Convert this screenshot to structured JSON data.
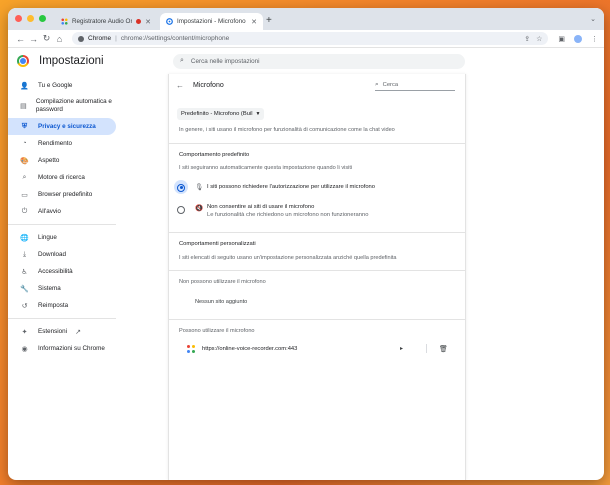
{
  "window": {
    "traffic_colors": [
      "#ff5f57",
      "#febc2e",
      "#28c840"
    ]
  },
  "tabs": [
    {
      "title": "Registratore Audio Online",
      "active": false,
      "recording": true
    },
    {
      "title": "Impostazioni - Microfono",
      "active": true,
      "recording": false
    }
  ],
  "toolbar": {
    "chip": "Chrome",
    "separator": "|",
    "url": "chrome://settings/content/microphone"
  },
  "header": {
    "title": "Impostazioni",
    "search_placeholder": "Cerca nelle impostazioni"
  },
  "sidebar": {
    "items": [
      {
        "label": "Tu e Google",
        "icon": "person-icon"
      },
      {
        "label": "Compilazione automatica e password",
        "icon": "clipboard-icon"
      },
      {
        "label": "Privacy e sicurezza",
        "icon": "shield-icon",
        "selected": true
      },
      {
        "label": "Rendimento",
        "icon": "speed-icon"
      },
      {
        "label": "Aspetto",
        "icon": "palette-icon"
      },
      {
        "label": "Motore di ricerca",
        "icon": "search-icon"
      },
      {
        "label": "Browser predefinito",
        "icon": "browser-icon"
      },
      {
        "label": "All'avvio",
        "icon": "power-icon"
      },
      {
        "label": "Lingue",
        "icon": "globe-icon"
      },
      {
        "label": "Download",
        "icon": "download-icon"
      },
      {
        "label": "Accessibilità",
        "icon": "accessibility-icon"
      },
      {
        "label": "Sistema",
        "icon": "wrench-icon"
      },
      {
        "label": "Reimposta",
        "icon": "reset-icon"
      },
      {
        "label": "Estensioni",
        "icon": "puzzle-icon"
      },
      {
        "label": "Informazioni su Chrome",
        "icon": "chrome-icon"
      }
    ]
  },
  "main": {
    "title": "Microfono",
    "search_placeholder": "Cerca",
    "device_select": "Predefinito - Microfono (Buil",
    "intro": "In genere, i siti usano il microfono per funzionalità di comunicazione come la chat video",
    "default_behavior": {
      "heading": "Comportamento predefinito",
      "description": "I siti seguiranno automaticamente questa impostazione quando li visiti",
      "option_allow": "I siti possono richiedere l'autorizzazione per utilizzare il microfono",
      "option_block_title": "Non consentire ai siti di usare il microfono",
      "option_block_sub": "Le funzionalità che richiedono un microfono non funzioneranno"
    },
    "custom_behavior": {
      "heading": "Comportamenti personalizzati",
      "description": "I siti elencati di seguito usano un'impostazione personalizzata anziché quella predefinita",
      "blocked_heading": "Non possono utilizzare il microfono",
      "blocked_empty": "Nessun sito aggiunto",
      "allowed_heading": "Possono utilizzare il microfono",
      "allowed_sites": [
        {
          "url": "https://online-voice-recorder.com:443"
        }
      ]
    }
  },
  "colors": {
    "accent": "#0b57d0",
    "selected_bg": "#d3e3fd"
  }
}
